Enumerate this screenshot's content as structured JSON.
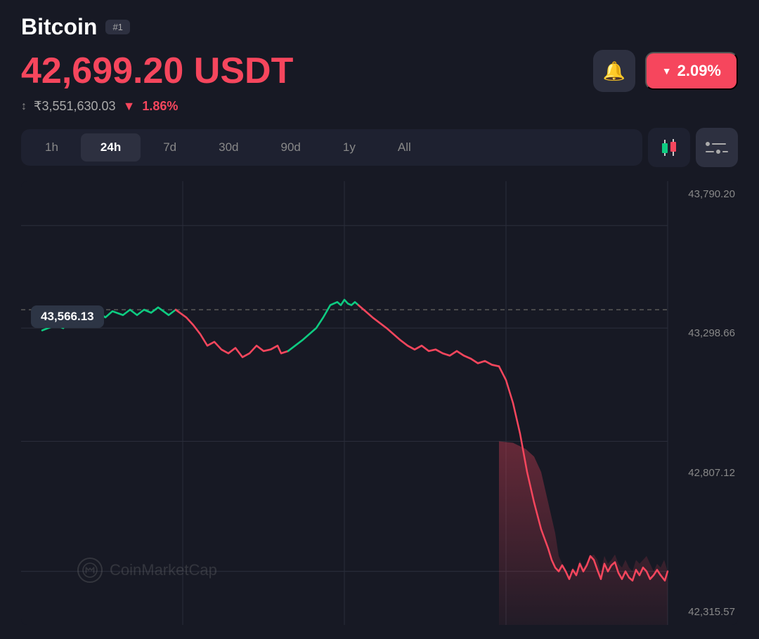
{
  "header": {
    "coin_name": "Bitcoin",
    "rank": "#1"
  },
  "price": {
    "current": "42,699.20 USDT",
    "inr": "₹3,551,630.03",
    "change_pct_24h": "1.86%",
    "change_badge": "2.09%"
  },
  "timeframes": [
    {
      "label": "1h",
      "active": false
    },
    {
      "label": "24h",
      "active": true
    },
    {
      "label": "7d",
      "active": false
    },
    {
      "label": "30d",
      "active": false
    },
    {
      "label": "90d",
      "active": false
    },
    {
      "label": "1y",
      "active": false
    },
    {
      "label": "All",
      "active": false
    }
  ],
  "chart": {
    "price_labels": [
      "43,790.20",
      "43,298.66",
      "42,807.12",
      "42,315.57"
    ],
    "hover_label": "43,566.13",
    "watermark_text": "CoinMarketCap"
  },
  "colors": {
    "bg": "#171924",
    "card_bg": "#1e2130",
    "button_bg": "#2d3040",
    "up": "#0ecb81",
    "down": "#f6465d",
    "accent": "#f0b90b"
  }
}
